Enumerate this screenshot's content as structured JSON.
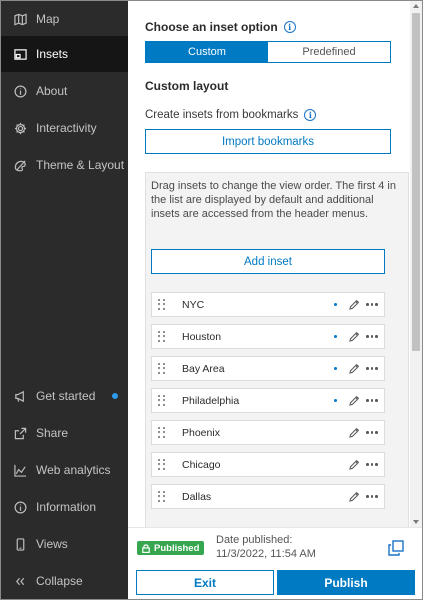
{
  "sidebar": {
    "items": [
      {
        "label": "Map",
        "icon": "map-icon",
        "active": false
      },
      {
        "label": "Insets",
        "icon": "insets-icon",
        "active": true
      },
      {
        "label": "About",
        "icon": "info-icon",
        "active": false
      },
      {
        "label": "Interactivity",
        "icon": "gear-icon",
        "active": false
      },
      {
        "label": "Theme & Layout",
        "icon": "palette-icon",
        "active": false
      }
    ],
    "bottom_items": [
      {
        "label": "Get started",
        "icon": "megaphone-icon",
        "has_dot": true
      },
      {
        "label": "Share",
        "icon": "share-icon"
      },
      {
        "label": "Web analytics",
        "icon": "analytics-icon"
      },
      {
        "label": "Information",
        "icon": "info-icon"
      },
      {
        "label": "Views",
        "icon": "phone-icon"
      },
      {
        "label": "Collapse",
        "icon": "chevrons-left-icon"
      }
    ]
  },
  "panel": {
    "heading": "Choose an inset option",
    "options": {
      "selected": "Custom",
      "other": "Predefined"
    },
    "subheading": "Custom layout",
    "bookmarks_label": "Create insets from bookmarks",
    "import_button": "Import bookmarks",
    "help_text": "Drag insets to change the view order. The first 4 in the list are displayed by default and additional insets are accessed from the header menus.",
    "add_button": "Add inset",
    "insets": [
      {
        "name": "NYC",
        "default_shown": true
      },
      {
        "name": "Houston",
        "default_shown": true
      },
      {
        "name": "Bay Area",
        "default_shown": true
      },
      {
        "name": "Philadelphia",
        "default_shown": true
      },
      {
        "name": "Phoenix",
        "default_shown": false
      },
      {
        "name": "Chicago",
        "default_shown": false
      },
      {
        "name": "Dallas",
        "default_shown": false
      }
    ]
  },
  "footer": {
    "status_badge": "Published",
    "date_label": "Date published:",
    "date_value": "11/3/2022, 11:54 AM",
    "exit_button": "Exit",
    "publish_button": "Publish"
  },
  "colors": {
    "accent": "#007ac2",
    "sidebar_bg": "#2b2b2b",
    "published": "#36a64f"
  }
}
